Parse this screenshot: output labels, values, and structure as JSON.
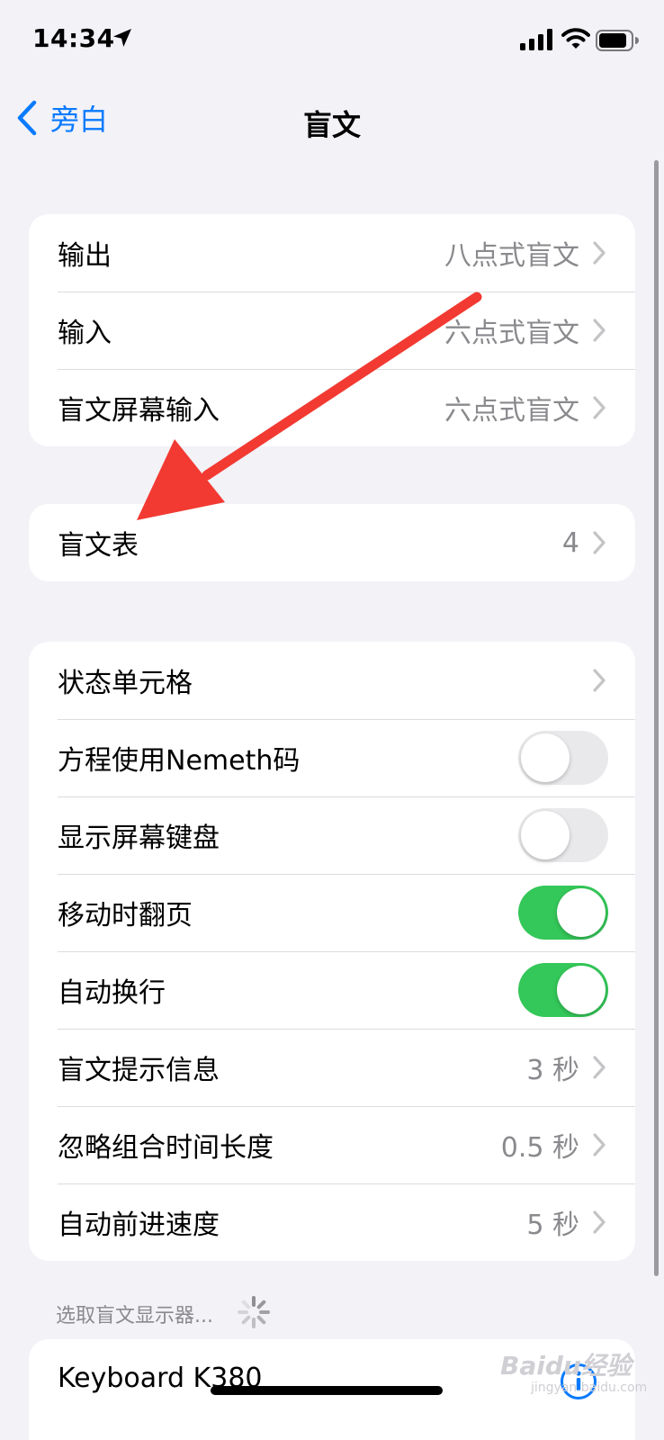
{
  "status_bar": {
    "time": "14:34"
  },
  "nav": {
    "back_label": "旁白",
    "title": "盲文"
  },
  "group1": {
    "rows": [
      {
        "label": "输出",
        "value": "八点式盲文"
      },
      {
        "label": "输入",
        "value": "六点式盲文"
      },
      {
        "label": "盲文屏幕输入",
        "value": "六点式盲文"
      }
    ]
  },
  "group2": {
    "rows": [
      {
        "label": "盲文表",
        "value": "4"
      }
    ]
  },
  "group3": {
    "rows": [
      {
        "label": "状态单元格",
        "value": ""
      },
      {
        "label": "方程使用Nemeth码",
        "toggle": false
      },
      {
        "label": "显示屏幕键盘",
        "toggle": false
      },
      {
        "label": "移动时翻页",
        "toggle": true
      },
      {
        "label": "自动换行",
        "toggle": true
      },
      {
        "label": "盲文提示信息",
        "value": "3 秒"
      },
      {
        "label": "忽略组合时间长度",
        "value": "0.5 秒"
      },
      {
        "label": "自动前进速度",
        "value": "5 秒"
      }
    ]
  },
  "display_section": {
    "header": "选取盲文显示器...",
    "devices": [
      {
        "name": "Keyboard K380"
      }
    ]
  },
  "watermark": {
    "brand": "Baidu经验",
    "url": "jingyan.baidu.com"
  },
  "colors": {
    "accent": "#0a7aff",
    "toggle_on": "#34c759",
    "toggle_off": "#e9e9eb",
    "annotation": "#f23a32",
    "background": "#f2f2f7"
  },
  "icons": {
    "location": "location-arrow-icon",
    "signal": "cellular-signal-icon",
    "wifi": "wifi-icon",
    "battery": "battery-icon",
    "back": "chevron-left-icon",
    "row": "chevron-right-icon",
    "loading": "spinner-icon",
    "info": "info-icon"
  }
}
